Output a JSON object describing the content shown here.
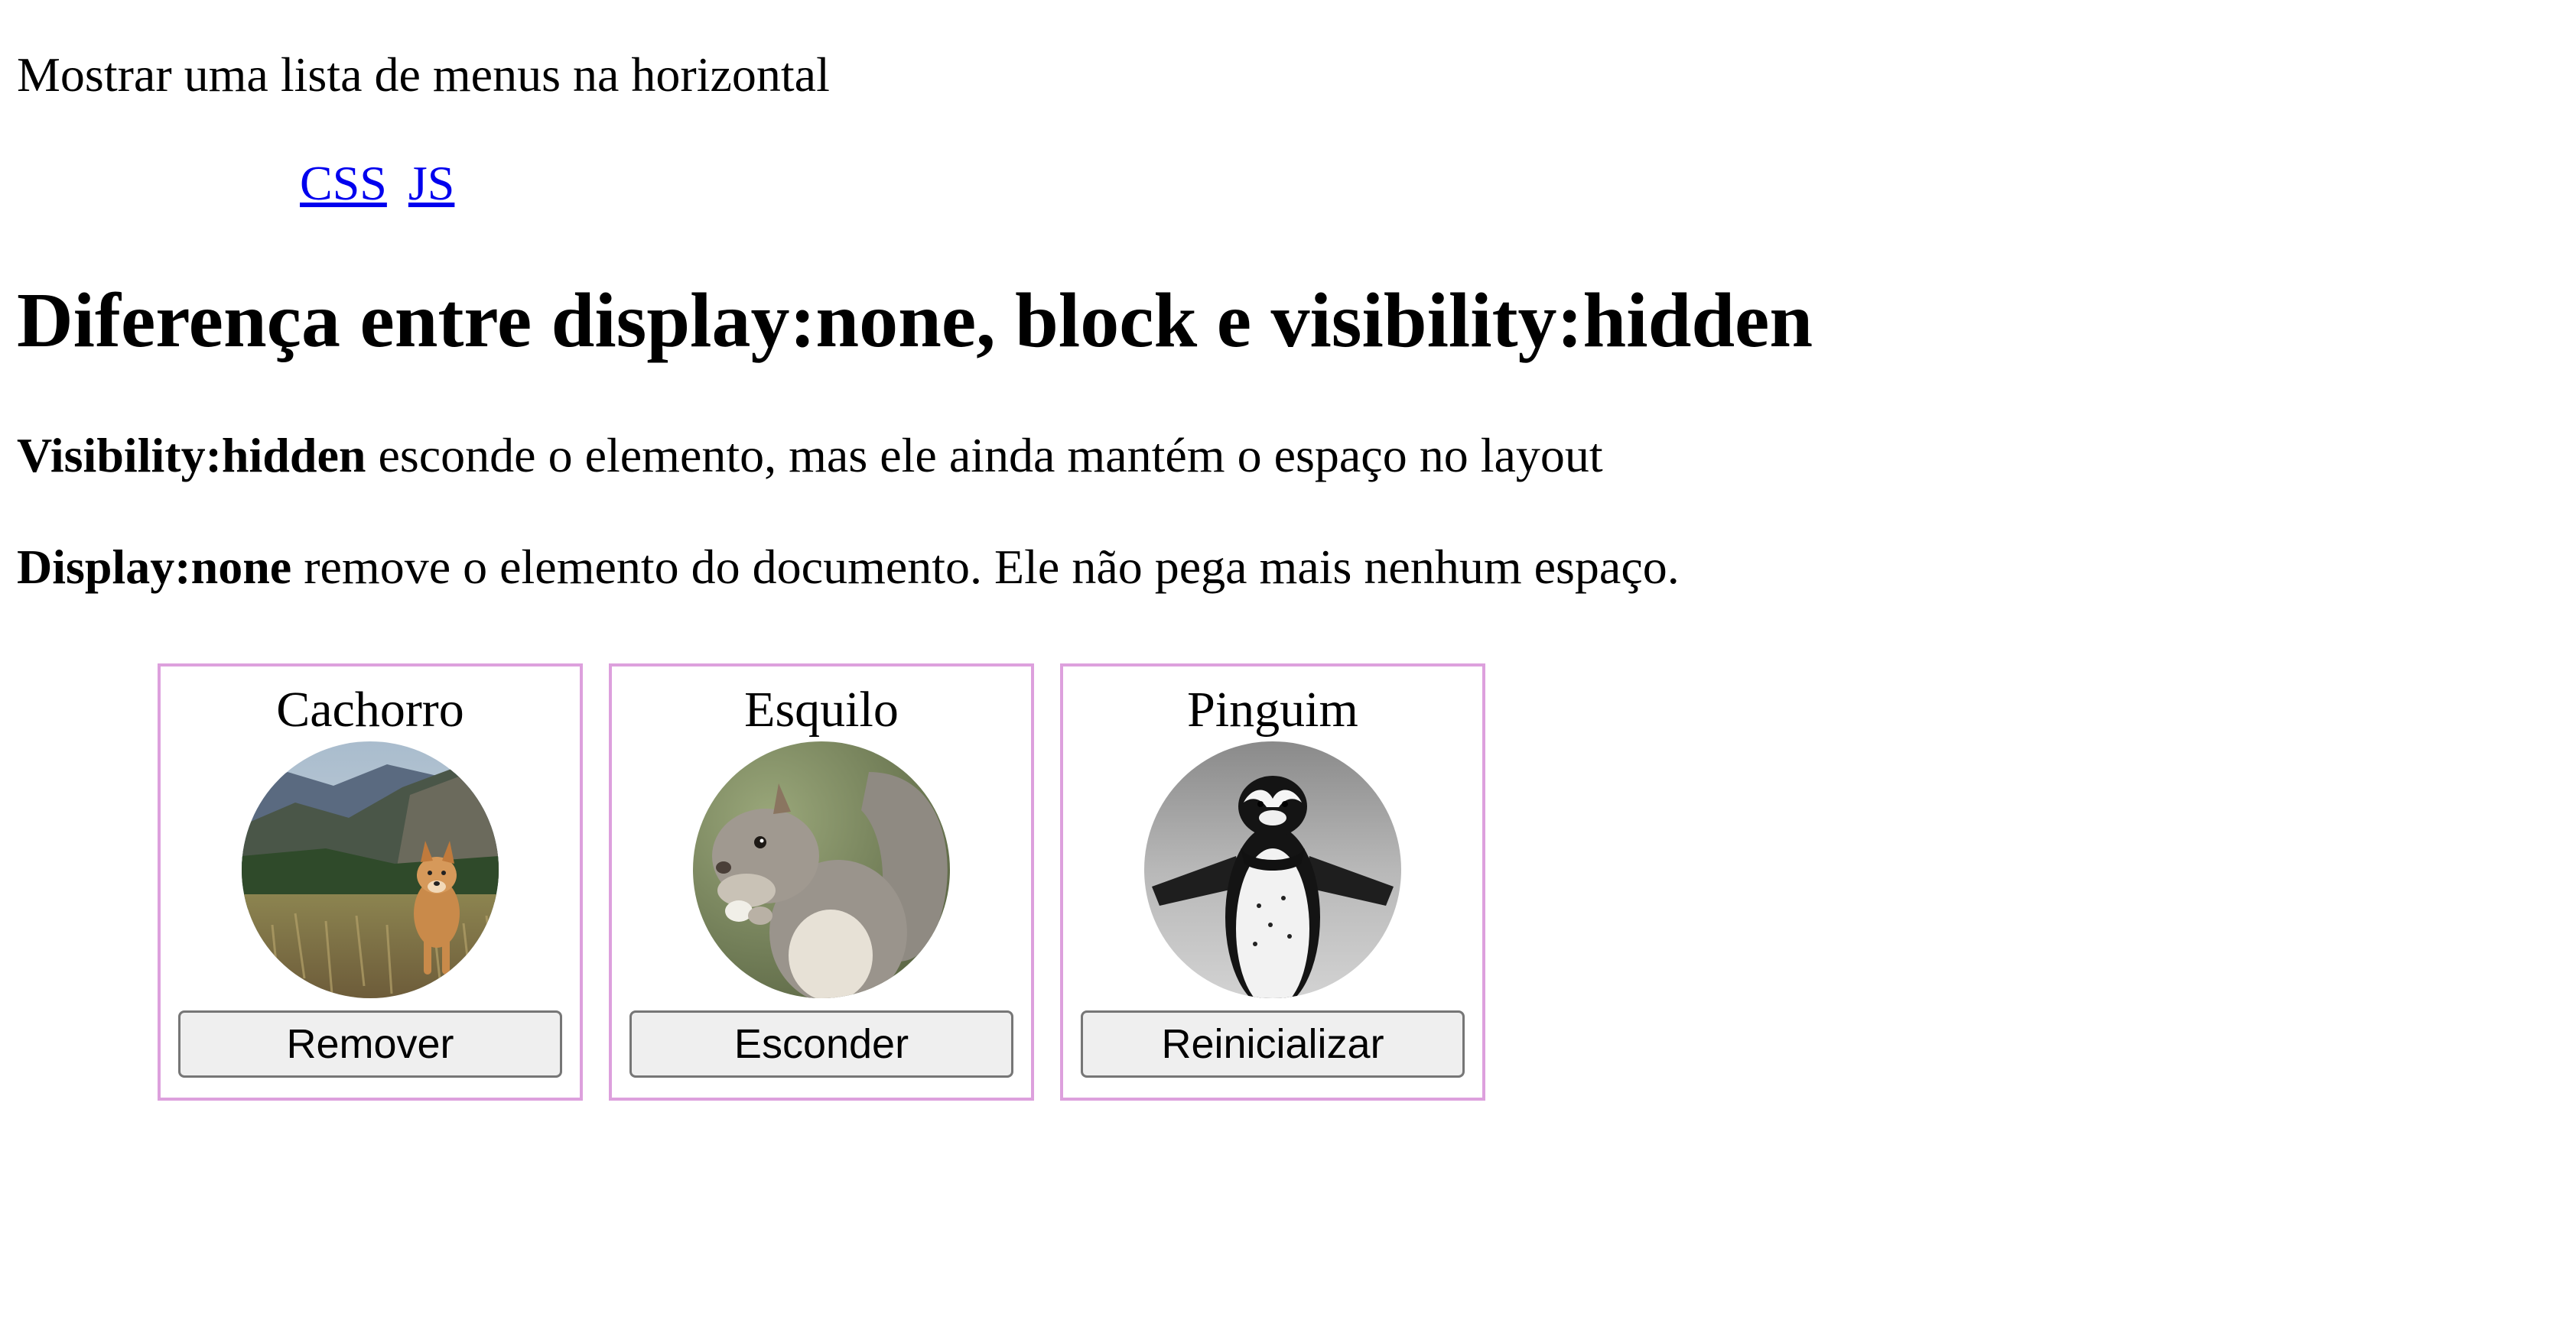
{
  "intro_text": "Mostrar uma lista de menus na horizontal",
  "menu": [
    {
      "label": "CSS"
    },
    {
      "label": "JS"
    }
  ],
  "heading": "Diferença entre display:none, block e visibility:hidden",
  "paragraphs": [
    {
      "bold": "Visibility:hidden",
      "rest": " esconde o elemento, mas ele ainda mantém o espaço no layout"
    },
    {
      "bold": "Display:none",
      "rest": " remove o elemento do documento. Ele não pega mais nenhum espaço."
    }
  ],
  "cards": [
    {
      "name": "Cachorro",
      "button": "Remover",
      "image": "dog-photo"
    },
    {
      "name": "Esquilo",
      "button": "Esconder",
      "image": "squirrel-photo"
    },
    {
      "name": "Pinguim",
      "button": "Reinicializar",
      "image": "penguin-photo"
    }
  ],
  "colors": {
    "link": "#0000ee",
    "card_border": "#dda0dd",
    "button_bg": "#efefef",
    "button_border": "#767676"
  }
}
